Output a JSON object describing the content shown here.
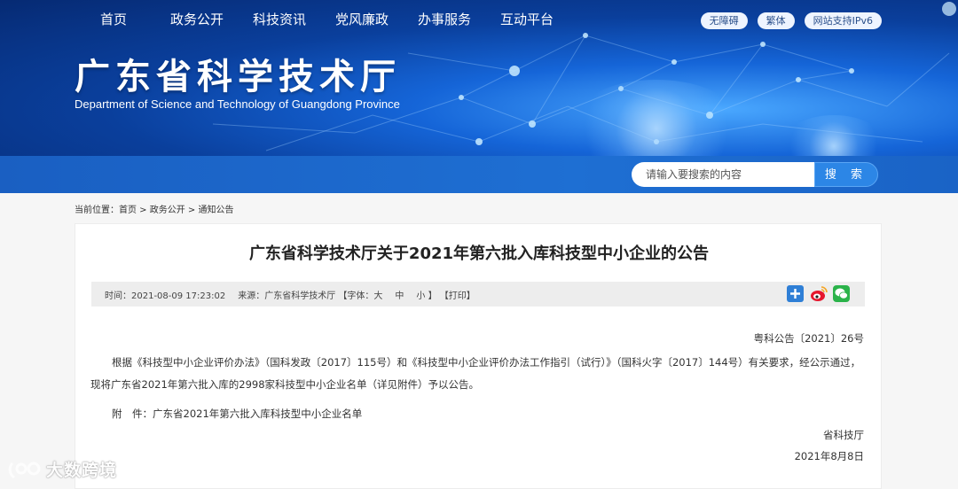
{
  "header": {
    "title_zh": "广东省科学技术厅",
    "title_en": "Department of Science and Technology of Guangdong Province",
    "top_links": [
      "无障碍",
      "繁体",
      "网站支持IPv6"
    ]
  },
  "nav": {
    "items": [
      "首页",
      "政务公开",
      "科技资讯",
      "党风廉政",
      "办事服务",
      "互动平台"
    ],
    "search_placeholder": "请输入要搜索的内容",
    "search_button": "搜 索"
  },
  "breadcrumb": {
    "prefix": "当前位置：",
    "items": [
      "首页",
      "政务公开",
      "通知公告"
    ],
    "separator": " > "
  },
  "article": {
    "title": "广东省科学技术厅关于2021年第六批入库科技型中小企业的公告",
    "meta": {
      "time": "时间：2021-08-09 17:23:02",
      "source": "来源：广东省科学技术厅",
      "font_label": "【字体：",
      "font_large": "大",
      "font_medium": "中",
      "font_small": "小",
      "font_close": "】",
      "print": "【打印】"
    },
    "share_icons": [
      "share-plus-icon",
      "weibo-icon",
      "wechat-icon"
    ],
    "doc_number": "粤科公告〔2021〕26号",
    "paragraph": "根据《科技型中小企业评价办法》（国科发政〔2017〕115号）和《科技型中小企业评价办法工作指引（试行）》（国科火字〔2017〕144号）有关要求，经公示通过，现将广东省2021年第六批入库的2998家科技型中小企业名单（详见附件）予以公告。",
    "attachment": "附　件：广东省2021年第六批入库科技型中小企业名单",
    "signature": "省科技厅",
    "date": "2021年8月8日"
  },
  "watermark": {
    "text": "大数跨境"
  },
  "colors": {
    "banner_dark": "#062a73",
    "nav_blue": "#1e6fd3",
    "search_button": "#2c86e6",
    "meta_bar": "#ededed"
  }
}
